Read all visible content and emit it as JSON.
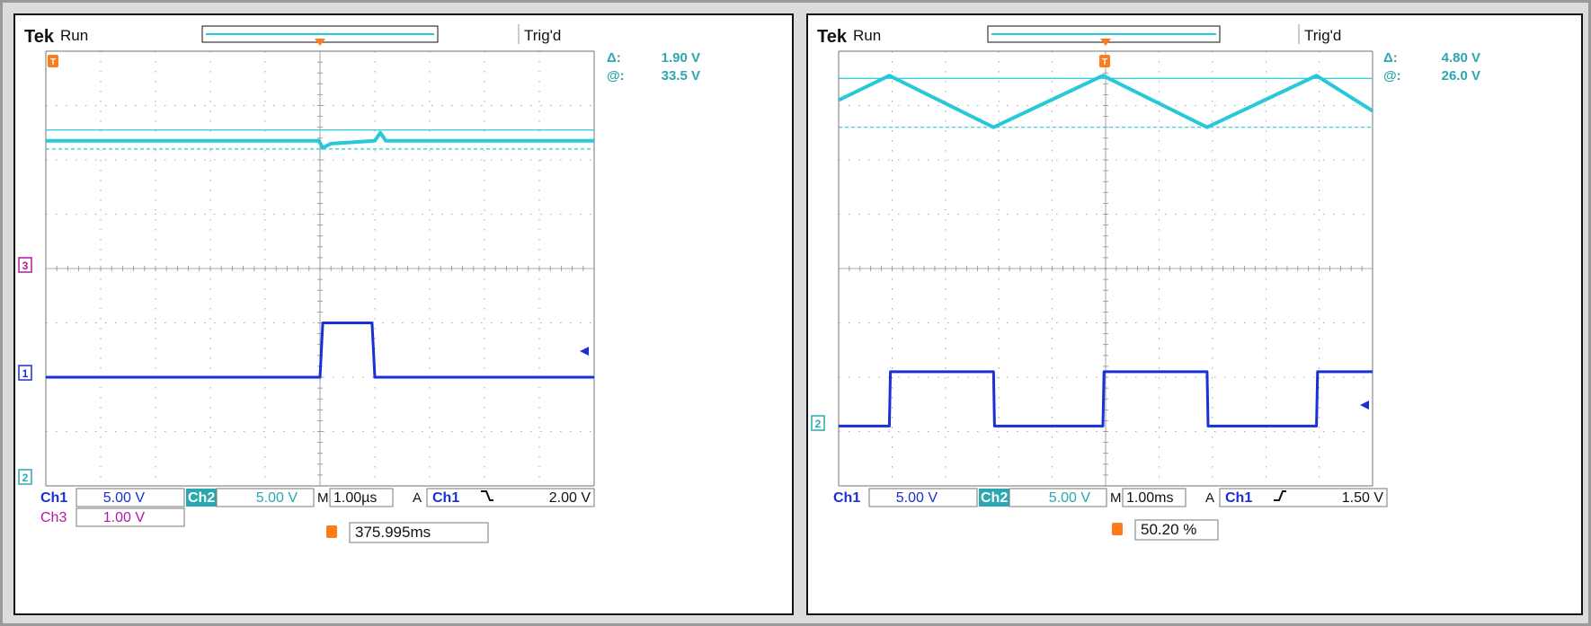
{
  "colors": {
    "ch1": "#1a2fd6",
    "ch2": "#2aa7b0",
    "ch3": "#b01aa8",
    "cursor": "#27c8d8",
    "trigger": "#ff7a1a",
    "grid": "#8c8c8c",
    "text": "#111111"
  },
  "screens": [
    {
      "id": "left",
      "header": {
        "brand": "Tek",
        "mode": "Run",
        "status": "Trig'd"
      },
      "cursor_readout": {
        "delta": "1.90 V",
        "at": "33.5 V"
      },
      "channel_markers": [
        {
          "label": "3",
          "color": "#b01aa8"
        },
        {
          "label": "1",
          "color": "#1a2fd6"
        },
        {
          "label": "2",
          "color": "#2aa7b0"
        }
      ],
      "bottom": {
        "row1": [
          {
            "ch": "Ch1",
            "scale": "5.00 V"
          },
          {
            "ch": "Ch2",
            "scale": "5.00 V"
          }
        ],
        "row2": [
          {
            "ch": "Ch3",
            "scale": "1.00 V"
          }
        ],
        "timebase": "1.00µs",
        "timebase_prefix": "M",
        "trigger_prefix": "A",
        "trigger_source": "Ch1",
        "trigger_slope": "falling",
        "trigger_level": "2.00 V",
        "footer": "375.995ms"
      },
      "chart_data": {
        "type": "line",
        "xlim": [
          0,
          10
        ],
        "ylim": [
          0,
          8
        ],
        "grid": true,
        "series": [
          {
            "values": [
              [
                0,
                6.35
              ],
              [
                4.98,
                6.35
              ],
              [
                5.05,
                6.22
              ],
              [
                5.2,
                6.3
              ],
              [
                6,
                6.35
              ],
              [
                6.1,
                6.5
              ],
              [
                6.2,
                6.35
              ],
              [
                10,
                6.35
              ]
            ]
          },
          {
            "values": [
              [
                0,
                2.0
              ],
              [
                5.0,
                2.0
              ],
              [
                5.05,
                3.0
              ],
              [
                5.95,
                3.0
              ],
              [
                6.0,
                2.0
              ],
              [
                10,
                2.0
              ]
            ]
          }
        ],
        "cursor_lines": [
          6.55,
          6.2
        ]
      }
    },
    {
      "id": "right",
      "header": {
        "brand": "Tek",
        "mode": "Run",
        "status": "Trig'd"
      },
      "cursor_readout": {
        "delta": "4.80 V",
        "at": "26.0 V"
      },
      "channel_markers": [
        {
          "label": "2",
          "color": "#2aa7b0"
        }
      ],
      "bottom": {
        "row1": [
          {
            "ch": "Ch1",
            "scale": "5.00 V"
          },
          {
            "ch": "Ch2",
            "scale": "5.00 V"
          }
        ],
        "row2": [],
        "timebase": "1.00ms",
        "timebase_prefix": "M",
        "trigger_prefix": "A",
        "trigger_source": "Ch1",
        "trigger_slope": "rising",
        "trigger_level": "1.50 V",
        "footer": "50.20 %"
      },
      "chart_data": {
        "type": "line",
        "xlim": [
          0,
          10
        ],
        "ylim": [
          0,
          8
        ],
        "grid": true,
        "series": [
          {
            "values": [
              [
                0,
                7.1
              ],
              [
                0.95,
                7.55
              ],
              [
                2.9,
                6.6
              ],
              [
                4.95,
                7.55
              ],
              [
                6.9,
                6.6
              ],
              [
                8.95,
                7.55
              ],
              [
                10,
                6.9
              ]
            ]
          },
          {
            "values": [
              [
                0,
                1.1
              ],
              [
                0.95,
                1.1
              ],
              [
                0.97,
                2.1
              ],
              [
                2.9,
                2.1
              ],
              [
                2.92,
                1.1
              ],
              [
                4.95,
                1.1
              ],
              [
                4.97,
                2.1
              ],
              [
                6.9,
                2.1
              ],
              [
                6.92,
                1.1
              ],
              [
                8.95,
                1.1
              ],
              [
                8.97,
                2.1
              ],
              [
                10,
                2.1
              ]
            ]
          }
        ],
        "cursor_lines": [
          7.5,
          6.6
        ]
      }
    }
  ]
}
